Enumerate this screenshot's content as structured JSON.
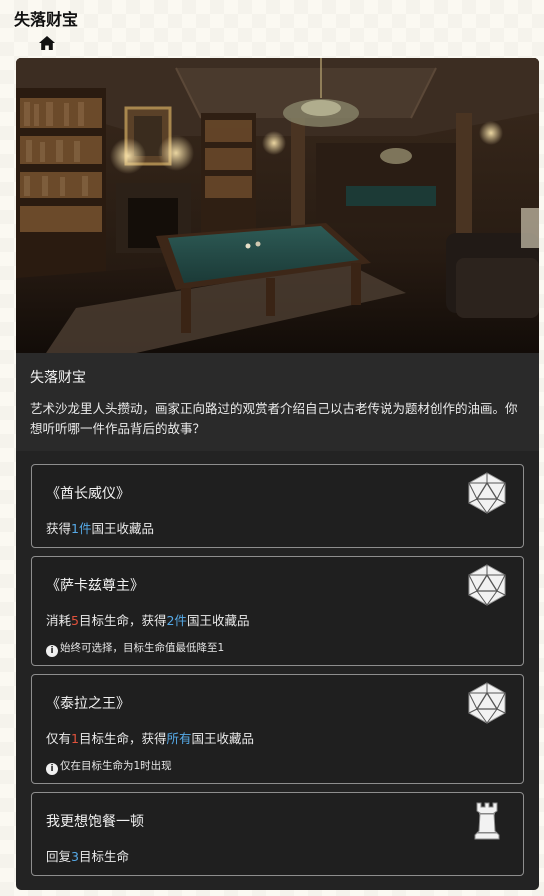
{
  "app": {
    "title": "失落财宝"
  },
  "nav": {
    "home_icon": "home-icon"
  },
  "event": {
    "title": "失落财宝",
    "description": "艺术沙龙里人头攒动，画家正向路过的观赏者介绍自己以古老传说为题材创作的油画。你想听听哪一件作品背后的故事？",
    "scene": "billiard-room-scene"
  },
  "options": [
    {
      "title": "《酋长威仪》",
      "effect": {
        "p1": "获得",
        "v1": "1件",
        "p2": "国王收藏品"
      },
      "icon": "d20-icon"
    },
    {
      "title": "《萨卡兹尊主》",
      "effect": {
        "p1": "消耗",
        "v1": "5",
        "p2": "目标生命，获得",
        "v2": "2件",
        "p3": "国王收藏品"
      },
      "note": "始终可选择，目标生命值最低降至1",
      "icon": "d20-icon"
    },
    {
      "title": "《泰拉之王》",
      "effect": {
        "p1": "仅有",
        "v1": "1",
        "p2": "目标生命，获得",
        "v2": "所有",
        "p3": "国王收藏品"
      },
      "note": "仅在目标生命为1时出现",
      "icon": "d20-icon"
    },
    {
      "title": "我更想饱餐一顿",
      "effect": {
        "p1": "回复",
        "v1": "3",
        "p2": "目标生命"
      },
      "icon": "chess-rook-icon"
    }
  ],
  "colors": {
    "highlight_blue": "#56a9e6",
    "highlight_red": "#e0523c",
    "card_bg": "#232323",
    "option_border": "#8e8e8e"
  }
}
